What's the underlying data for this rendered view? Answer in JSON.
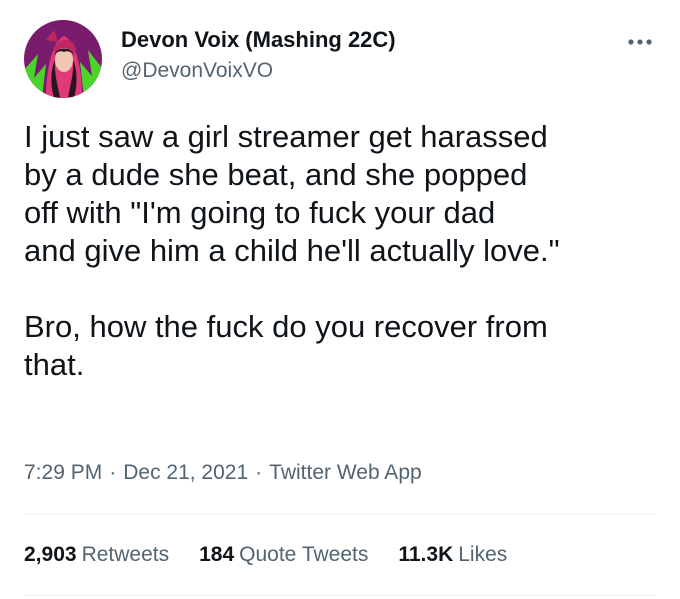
{
  "author": {
    "display_name": "Devon Voix (Mashing 22C)",
    "handle": "@DevonVoixVO",
    "avatar_icon": "avatar-image"
  },
  "menu": {
    "icon": "more-options-icon"
  },
  "tweet": {
    "paragraph_1": [
      "I just saw a girl streamer get harassed",
      "by a dude she beat, and she popped",
      "off with \"I'm going to fuck your dad",
      "and give him a child he'll actually love.\""
    ],
    "paragraph_2": [
      "Bro, how the fuck do you recover from",
      "that."
    ]
  },
  "meta": {
    "time": "7:29 PM",
    "separator": "·",
    "date": "Dec 21, 2021",
    "source": "Twitter Web App"
  },
  "stats": {
    "retweets_count": "2,903",
    "retweets_label": "Retweets",
    "quotes_count": "184",
    "quotes_label": "Quote Tweets",
    "likes_count": "11.3K",
    "likes_label": "Likes"
  },
  "colors": {
    "text_primary": "#0f1419",
    "text_secondary": "#536471",
    "divider": "#eff3f4",
    "avatar_background": "#7a1c6e",
    "avatar_accent": "#4ad42a"
  }
}
